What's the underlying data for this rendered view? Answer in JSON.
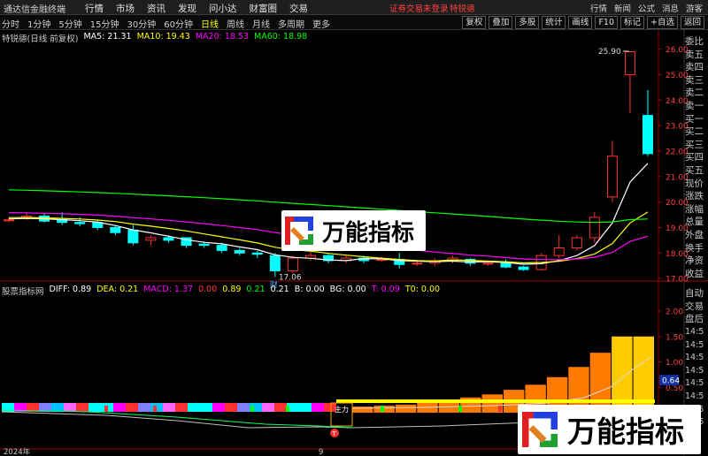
{
  "top_bar": {
    "app_name": "通达信金融终端",
    "menus": [
      "行情",
      "市场",
      "资讯",
      "发现",
      "问小达",
      "财富圈",
      "交易"
    ],
    "status": "证券交易未登录",
    "user": "特锐德",
    "right_items": [
      "行情",
      "新闻",
      "公式",
      "消息"
    ],
    "guest": "游客"
  },
  "period_bar": {
    "periods": [
      "分时",
      "1分钟",
      "5分钟",
      "15分钟",
      "30分钟",
      "60分钟",
      "日线",
      "周线",
      "月线",
      "多周期",
      "更多"
    ],
    "active": "日线",
    "tools": [
      "复权",
      "叠加",
      "多股",
      "统计",
      "画线",
      "F10",
      "标记",
      "+自选",
      "返回"
    ]
  },
  "main_info": {
    "title": "特锐德(日线 前复权)",
    "ma5": "MA5: 21.31",
    "ma10": "MA10: 19.43",
    "ma20": "MA20: 18.53",
    "ma60": "MA60: 18.98"
  },
  "price_axis": [
    "26.00",
    "25.00",
    "24.00",
    "23.00",
    "22.00",
    "21.00",
    "20.00",
    "19.00",
    "18.00",
    "17.00"
  ],
  "annotations": {
    "high": "25.90",
    "low": "17.06",
    "finance_marker": "财"
  },
  "sub_info": {
    "indicator": "股票指标网",
    "diff": "DIFF: 0.89",
    "dea": "DEA: 0.21",
    "macd": "MACD: 1.37",
    "v1": "0.00",
    "v2": "0.89",
    "v3": "0.21",
    "v4": "0.21",
    "b": "B: 0.00",
    "bg": "BG: 0.00",
    "t": "T: 0.09",
    "t0": "T0: 0.00"
  },
  "sub_axis": [
    "2.00",
    "1.50",
    "1.00",
    "0.50"
  ],
  "sub_current": "0.64",
  "sub_labels": {
    "buy_mark": "买",
    "mark": "主力\n资金",
    "t_mark": "T"
  },
  "x_axis": {
    "year": "2024年",
    "month": "9"
  },
  "right_column": {
    "labels": [
      "委比",
      "卖五",
      "卖四",
      "卖三",
      "卖二",
      "卖一",
      "买一",
      "买二",
      "买三",
      "买四",
      "买五",
      "现价",
      "涨跌",
      "涨幅",
      "总量",
      "外盘",
      "换手",
      "净资",
      "收益"
    ],
    "labels2": [
      "自动",
      "交易",
      "盘后"
    ],
    "times": [
      "14:5",
      "14:5",
      "14:5",
      "14:5",
      "14:5",
      "14:5",
      "14:5",
      "14:5"
    ]
  },
  "watermark": {
    "text": "万能指标"
  },
  "colors": {
    "up": "#ff3030",
    "down": "#00ffff",
    "ma5": "#ffffff",
    "ma10": "#ffff00",
    "ma20": "#ff00ff",
    "ma60": "#00ff00"
  },
  "chart_data": {
    "type": "candlestick",
    "price_range": [
      16.9,
      26.3
    ],
    "candles": [
      [
        19.3,
        19.4,
        19.2,
        19.3
      ],
      [
        19.4,
        19.6,
        19.3,
        19.45
      ],
      [
        19.45,
        19.55,
        19.2,
        19.25
      ],
      [
        19.3,
        19.6,
        19.1,
        19.2
      ],
      [
        19.2,
        19.4,
        19.05,
        19.15
      ],
      [
        19.2,
        19.3,
        18.9,
        19.0
      ],
      [
        19.0,
        19.1,
        18.7,
        18.8
      ],
      [
        18.9,
        19.1,
        18.3,
        18.4
      ],
      [
        18.5,
        18.7,
        18.3,
        18.6
      ],
      [
        18.6,
        18.7,
        18.4,
        18.5
      ],
      [
        18.6,
        18.6,
        18.2,
        18.3
      ],
      [
        18.35,
        18.45,
        18.2,
        18.3
      ],
      [
        18.3,
        18.4,
        18.0,
        18.1
      ],
      [
        18.1,
        18.2,
        17.9,
        18.0
      ],
      [
        18.0,
        18.1,
        17.8,
        17.95
      ],
      [
        17.9,
        18.0,
        17.06,
        17.3
      ],
      [
        17.3,
        17.9,
        17.2,
        17.8
      ],
      [
        17.8,
        18.1,
        17.7,
        17.9
      ],
      [
        17.9,
        18.0,
        17.6,
        17.7
      ],
      [
        17.7,
        17.9,
        17.6,
        17.8
      ],
      [
        17.8,
        17.9,
        17.6,
        17.7
      ],
      [
        17.75,
        17.85,
        17.65,
        17.75
      ],
      [
        17.75,
        18.0,
        17.4,
        17.55
      ],
      [
        17.6,
        17.7,
        17.5,
        17.6
      ],
      [
        17.6,
        17.8,
        17.5,
        17.7
      ],
      [
        17.7,
        17.9,
        17.6,
        17.8
      ],
      [
        17.75,
        17.8,
        17.5,
        17.6
      ],
      [
        17.6,
        17.7,
        17.5,
        17.6
      ],
      [
        17.65,
        17.75,
        17.4,
        17.45
      ],
      [
        17.45,
        17.5,
        17.3,
        17.35
      ],
      [
        17.35,
        18.0,
        17.3,
        17.9
      ],
      [
        17.9,
        18.7,
        17.8,
        18.2
      ],
      [
        18.2,
        18.7,
        18.1,
        18.6
      ],
      [
        18.6,
        19.6,
        18.4,
        19.4
      ],
      [
        20.2,
        22.4,
        20.0,
        21.8
      ],
      [
        25.0,
        25.9,
        23.5,
        25.9
      ],
      [
        23.4,
        24.4,
        21.8,
        21.9
      ]
    ]
  }
}
